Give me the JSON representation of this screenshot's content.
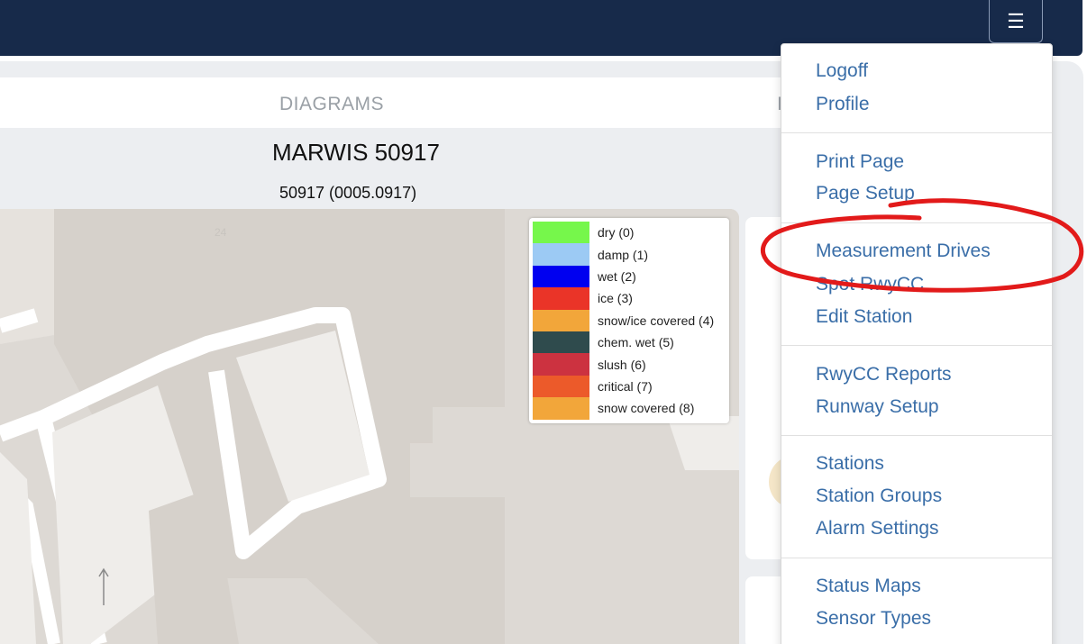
{
  "topbar": {
    "menu_icon": "hamburger-icon",
    "menu_glyph": "☰"
  },
  "tabs": {
    "diagrams": "DIAGRAMS",
    "next_partial": "I"
  },
  "station": {
    "title": "MARWIS 50917",
    "subtitle": "50917 (0005.0917)"
  },
  "map": {
    "road_label": "24"
  },
  "legend": [
    {
      "label": "dry (0)",
      "color": "#76f74b"
    },
    {
      "label": "damp (1)",
      "color": "#9ccaf4"
    },
    {
      "label": "wet (2)",
      "color": "#0000f0"
    },
    {
      "label": "ice (3)",
      "color": "#ea3428"
    },
    {
      "label": "snow/ice covered (4)",
      "color": "#f2a63a"
    },
    {
      "label": "chem. wet (5)",
      "color": "#2f4b4d"
    },
    {
      "label": "slush (6)",
      "color": "#cc3240"
    },
    {
      "label": "critical (7)",
      "color": "#ec5a2a"
    },
    {
      "label": "snow covered (8)",
      "color": "#f2a63a"
    }
  ],
  "menu": {
    "logoff": "Logoff",
    "profile": "Profile",
    "print_page": "Print Page",
    "page_setup": "Page Setup",
    "measurement_drives": "Measurement Drives",
    "spot_rwycc": "Spot RwyCC",
    "edit_station": "Edit Station",
    "rwycc_reports": "RwyCC Reports",
    "runway_setup": "Runway Setup",
    "stations": "Stations",
    "station_groups": "Station Groups",
    "alarm_settings": "Alarm Settings",
    "status_maps": "Status Maps",
    "sensor_types": "Sensor Types"
  },
  "colors": {
    "topbar": "#172a4a",
    "menu_link": "#3a6ea8",
    "annotation": "#e21a1a"
  }
}
